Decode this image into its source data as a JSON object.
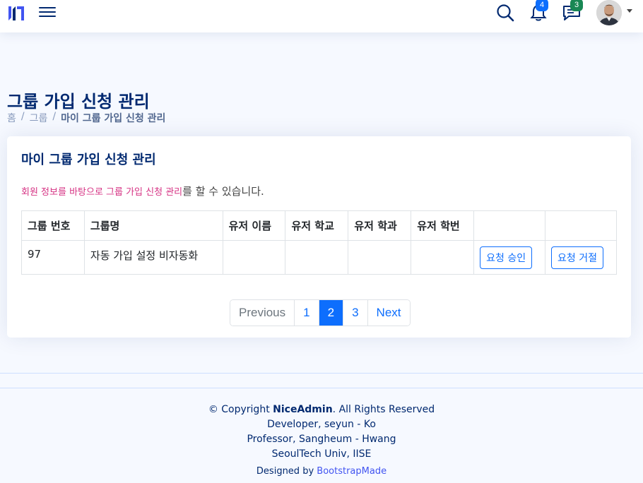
{
  "header": {
    "notifications_count": "4",
    "messages_count": "3",
    "badge_colors": {
      "notifications": "#0d6efd",
      "messages": "#198754"
    }
  },
  "page": {
    "title": "그룹 가입 신청 관리",
    "breadcrumb": [
      "홈",
      "그룹",
      "마이 그룹 가입 신청 관리"
    ]
  },
  "card": {
    "title": "마이 그룹 가입 신청 관리",
    "desc_highlight": "회원 정보를 바탕으로 그룹 가입 신청 관리",
    "desc_rest": "를 할 수 있습니다."
  },
  "table": {
    "headers": [
      "그룹 번호",
      "그룹명",
      "유저 이름",
      "유저 학교",
      "유저 학과",
      "유저 학번",
      "",
      ""
    ],
    "rows": [
      {
        "group_no": "97",
        "group_name": "자동 가입 설정 비자동화",
        "user_name": "",
        "user_school": "",
        "user_major": "",
        "user_id": "",
        "approve_label": "요청 승인",
        "reject_label": "요청 거절"
      }
    ]
  },
  "pagination": {
    "prev": "Previous",
    "pages": [
      "1",
      "2",
      "3"
    ],
    "current": "2",
    "next": "Next"
  },
  "footer": {
    "copyright_prefix": "© Copyright ",
    "brand": "NiceAdmin",
    "copyright_suffix": ". All Rights Reserved",
    "developer": "Developer, seyun - Ko",
    "professor": "Professor, Sangheum - Hwang",
    "university": "SeoulTech Univ, IISE",
    "designed_prefix": "Designed by ",
    "designed_link": "BootstrapMade"
  },
  "colors": {
    "accent": "#0d6efd",
    "title": "#012970",
    "highlight": "#d63384",
    "link": "#4154f1"
  }
}
